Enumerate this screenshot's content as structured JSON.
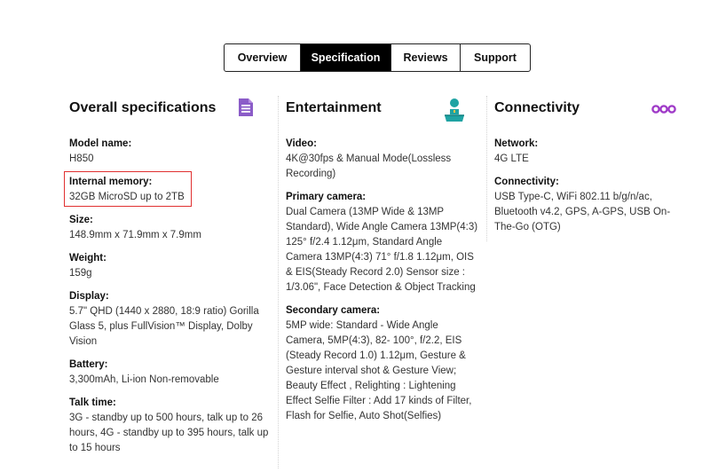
{
  "tabs": [
    {
      "label": "Overview",
      "active": false
    },
    {
      "label": "Specification",
      "active": true
    },
    {
      "label": "Reviews",
      "active": false
    },
    {
      "label": "Support",
      "active": false
    }
  ],
  "icons": {
    "overall": "document-list-icon",
    "entertainment": "person-at-desk-icon",
    "connectivity": "link-connection-icon"
  },
  "colors": {
    "accent_purple": "#8b5cc8",
    "accent_teal": "#1fa3a3",
    "highlight_red": "#e03030"
  },
  "overall": {
    "heading": "Overall specifications",
    "specs": [
      {
        "label": "Model name:",
        "value": "H850"
      },
      {
        "label": "Internal memory:",
        "value": "32GB MicroSD up to 2TB"
      },
      {
        "label": "Size:",
        "value": "148.9mm x 71.9mm x 7.9mm"
      },
      {
        "label": "Weight:",
        "value": "159g"
      },
      {
        "label": "Display:",
        "value": "5.7\" QHD (1440 x 2880, 18:9 ratio) Gorilla Glass 5, plus FullVision™ Display, Dolby Vision"
      },
      {
        "label": "Battery:",
        "value": "3,300mAh, Li-ion Non-removable"
      },
      {
        "label": "Talk time:",
        "value": "3G - standby up to 500 hours, talk up to 26 hours, 4G - standby up to 395 hours, talk up to 15 hours"
      }
    ]
  },
  "entertainment": {
    "heading": "Entertainment",
    "specs": [
      {
        "label": "Video:",
        "value": "4K@30fps & Manual Mode(Lossless Recording)"
      },
      {
        "label": "Primary camera:",
        "value": "Dual Camera (13MP Wide & 13MP Standard), Wide Angle Camera 13MP(4:3) 125° f/2.4 1.12μm, Standard Angle Camera 13MP(4:3) 71° f/1.8 1.12μm, OIS & EIS(Steady Record 2.0) Sensor size : 1/3.06\", Face Detection & Object Tracking"
      },
      {
        "label": "Secondary camera:",
        "value": "5MP wide: Standard - Wide Angle Camera, 5MP(4:3), 82- 100°, f/2.2, EIS (Steady Record 1.0) 1.12μm, Gesture & Gesture interval shot & Gesture View; Beauty Effect , Relighting : Lightening Effect Selfie Filter : Add 17 kinds of Filter, Flash for Selfie, Auto Shot(Selfies)"
      }
    ]
  },
  "connectivity": {
    "heading": "Connectivity",
    "specs": [
      {
        "label": "Network:",
        "value": "4G LTE"
      },
      {
        "label": "Connectivity:",
        "value": "USB Type-C, WiFi 802.11 b/g/n/ac, Bluetooth v4.2, GPS, A-GPS, USB On-The-Go (OTG)"
      }
    ]
  }
}
